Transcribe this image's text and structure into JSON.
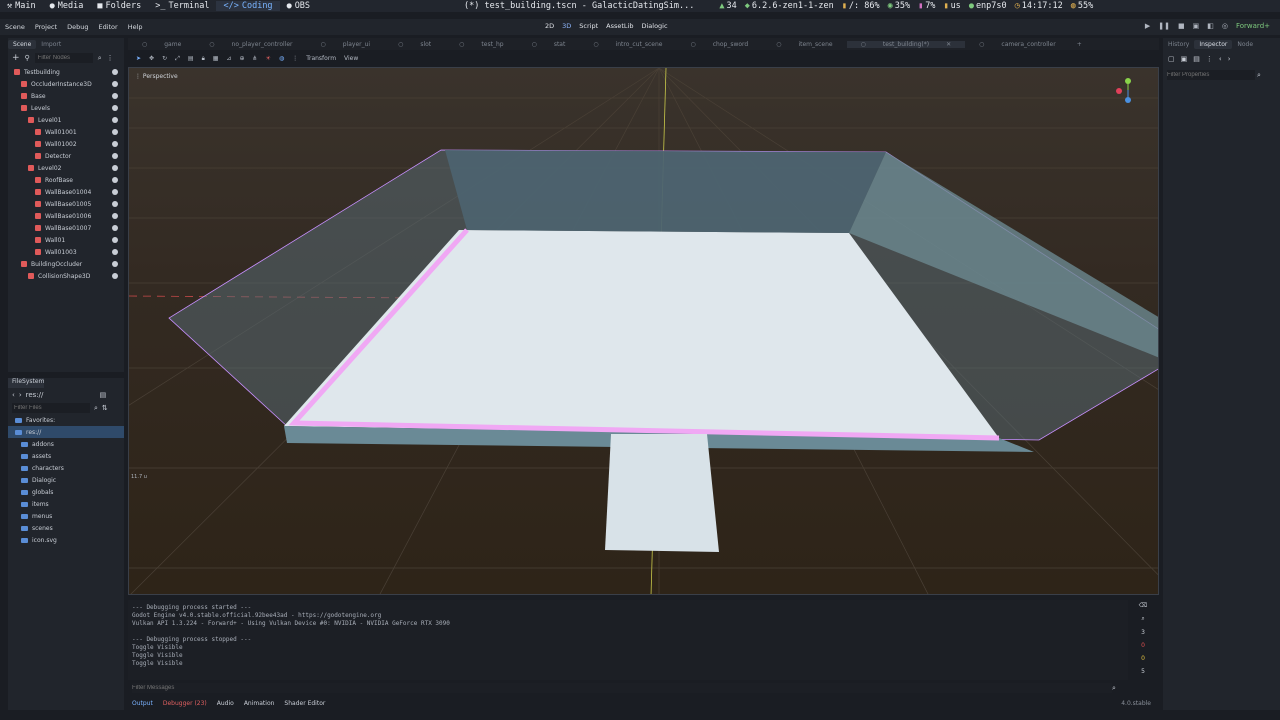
{
  "topbar": {
    "items": [
      {
        "icon": "⚒",
        "label": "Main"
      },
      {
        "icon": "●",
        "label": "Media"
      },
      {
        "icon": "■",
        "label": "Folders"
      },
      {
        "icon": ">_",
        "label": "Terminal"
      },
      {
        "icon": "</>",
        "label": "Coding"
      },
      {
        "icon": "●",
        "label": "OBS"
      }
    ],
    "window_title": "(*) test_building.tscn - GalacticDatingSim...",
    "stats": [
      "34",
      "6.2.6-zen1-1-zen",
      "/: 86%",
      "35%",
      "7%",
      "us",
      "enp7s0",
      "14:17:12",
      "55%"
    ]
  },
  "menu": {
    "items": [
      "Scene",
      "Project",
      "Debug",
      "Editor",
      "Help"
    ],
    "modes": [
      "2D",
      "3D",
      "Script",
      "AssetLib",
      "Dialogic"
    ],
    "renderer": "Forward+"
  },
  "scene_dock": {
    "tabs": [
      "Scene",
      "Import"
    ],
    "filter_placeholder": "Filter Nodes",
    "nodes": [
      {
        "label": "Testbuilding",
        "indent": 0,
        "color": "#e05a5a"
      },
      {
        "label": "OccluderInstance3D",
        "indent": 1,
        "color": "#e05a5a"
      },
      {
        "label": "Base",
        "indent": 1,
        "color": "#e05a5a"
      },
      {
        "label": "Levels",
        "indent": 1,
        "color": "#e05a5a"
      },
      {
        "label": "Level01",
        "indent": 2,
        "color": "#e05a5a"
      },
      {
        "label": "Wall01001",
        "indent": 3,
        "color": "#e05a5a"
      },
      {
        "label": "Wall01002",
        "indent": 3,
        "color": "#e05a5a"
      },
      {
        "label": "Detector",
        "indent": 3,
        "color": "#e05a5a"
      },
      {
        "label": "Level02",
        "indent": 2,
        "color": "#e05a5a"
      },
      {
        "label": "RoofBase",
        "indent": 3,
        "color": "#e05a5a"
      },
      {
        "label": "WallBase01004",
        "indent": 3,
        "color": "#e05a5a"
      },
      {
        "label": "WallBase01005",
        "indent": 3,
        "color": "#e05a5a"
      },
      {
        "label": "WallBase01006",
        "indent": 3,
        "color": "#e05a5a"
      },
      {
        "label": "WallBase01007",
        "indent": 3,
        "color": "#e05a5a"
      },
      {
        "label": "Wall01",
        "indent": 3,
        "color": "#e05a5a"
      },
      {
        "label": "Wall01003",
        "indent": 3,
        "color": "#e05a5a"
      },
      {
        "label": "BuildingOccluder",
        "indent": 1,
        "color": "#e05a5a"
      },
      {
        "label": "CollisionShape3D",
        "indent": 2,
        "color": "#e05a5a"
      }
    ]
  },
  "filesystem": {
    "title": "FileSystem",
    "path": "res://",
    "filter_placeholder": "Filter Files",
    "items": [
      "Favorites:",
      "res://",
      "addons",
      "assets",
      "characters",
      "Dialogic",
      "globals",
      "items",
      "menus",
      "scenes",
      "icon.svg"
    ]
  },
  "editor_tabs": [
    {
      "label": "game"
    },
    {
      "label": "no_player_controller"
    },
    {
      "label": "player_ui"
    },
    {
      "label": "slot"
    },
    {
      "label": "test_hp"
    },
    {
      "label": "stat"
    },
    {
      "label": "intro_cut_scene"
    },
    {
      "label": "chop_sword"
    },
    {
      "label": "item_scene"
    },
    {
      "label": "test_building(*)",
      "active": true
    },
    {
      "label": "camera_controller"
    }
  ],
  "toolbar": {
    "transform": "Transform",
    "view": "View"
  },
  "viewport": {
    "label": "Perspective",
    "zoom": "11.7 u"
  },
  "console": {
    "lines": [
      "--- Debugging process started ---",
      "Godot Engine v4.0.stable.official.92bee43ad - https://godotengine.org",
      "Vulkan API 1.3.224 - Forward+ - Using Vulkan Device #0: NVIDIA - NVIDIA GeForce RTX 3090",
      "",
      "--- Debugging process stopped ---",
      "Toggle Visible",
      "Toggle Visible",
      "Toggle Visible"
    ],
    "filter_placeholder": "Filter Messages",
    "counts": [
      "3",
      "0",
      "0",
      "5"
    ]
  },
  "bottom_tabs": [
    "Output",
    "Debugger (23)",
    "Audio",
    "Animation",
    "Shader Editor"
  ],
  "version": "4.0.stable",
  "inspector": {
    "tabs": [
      "History",
      "Inspector",
      "Node"
    ],
    "filter_placeholder": "Filter Properties"
  }
}
